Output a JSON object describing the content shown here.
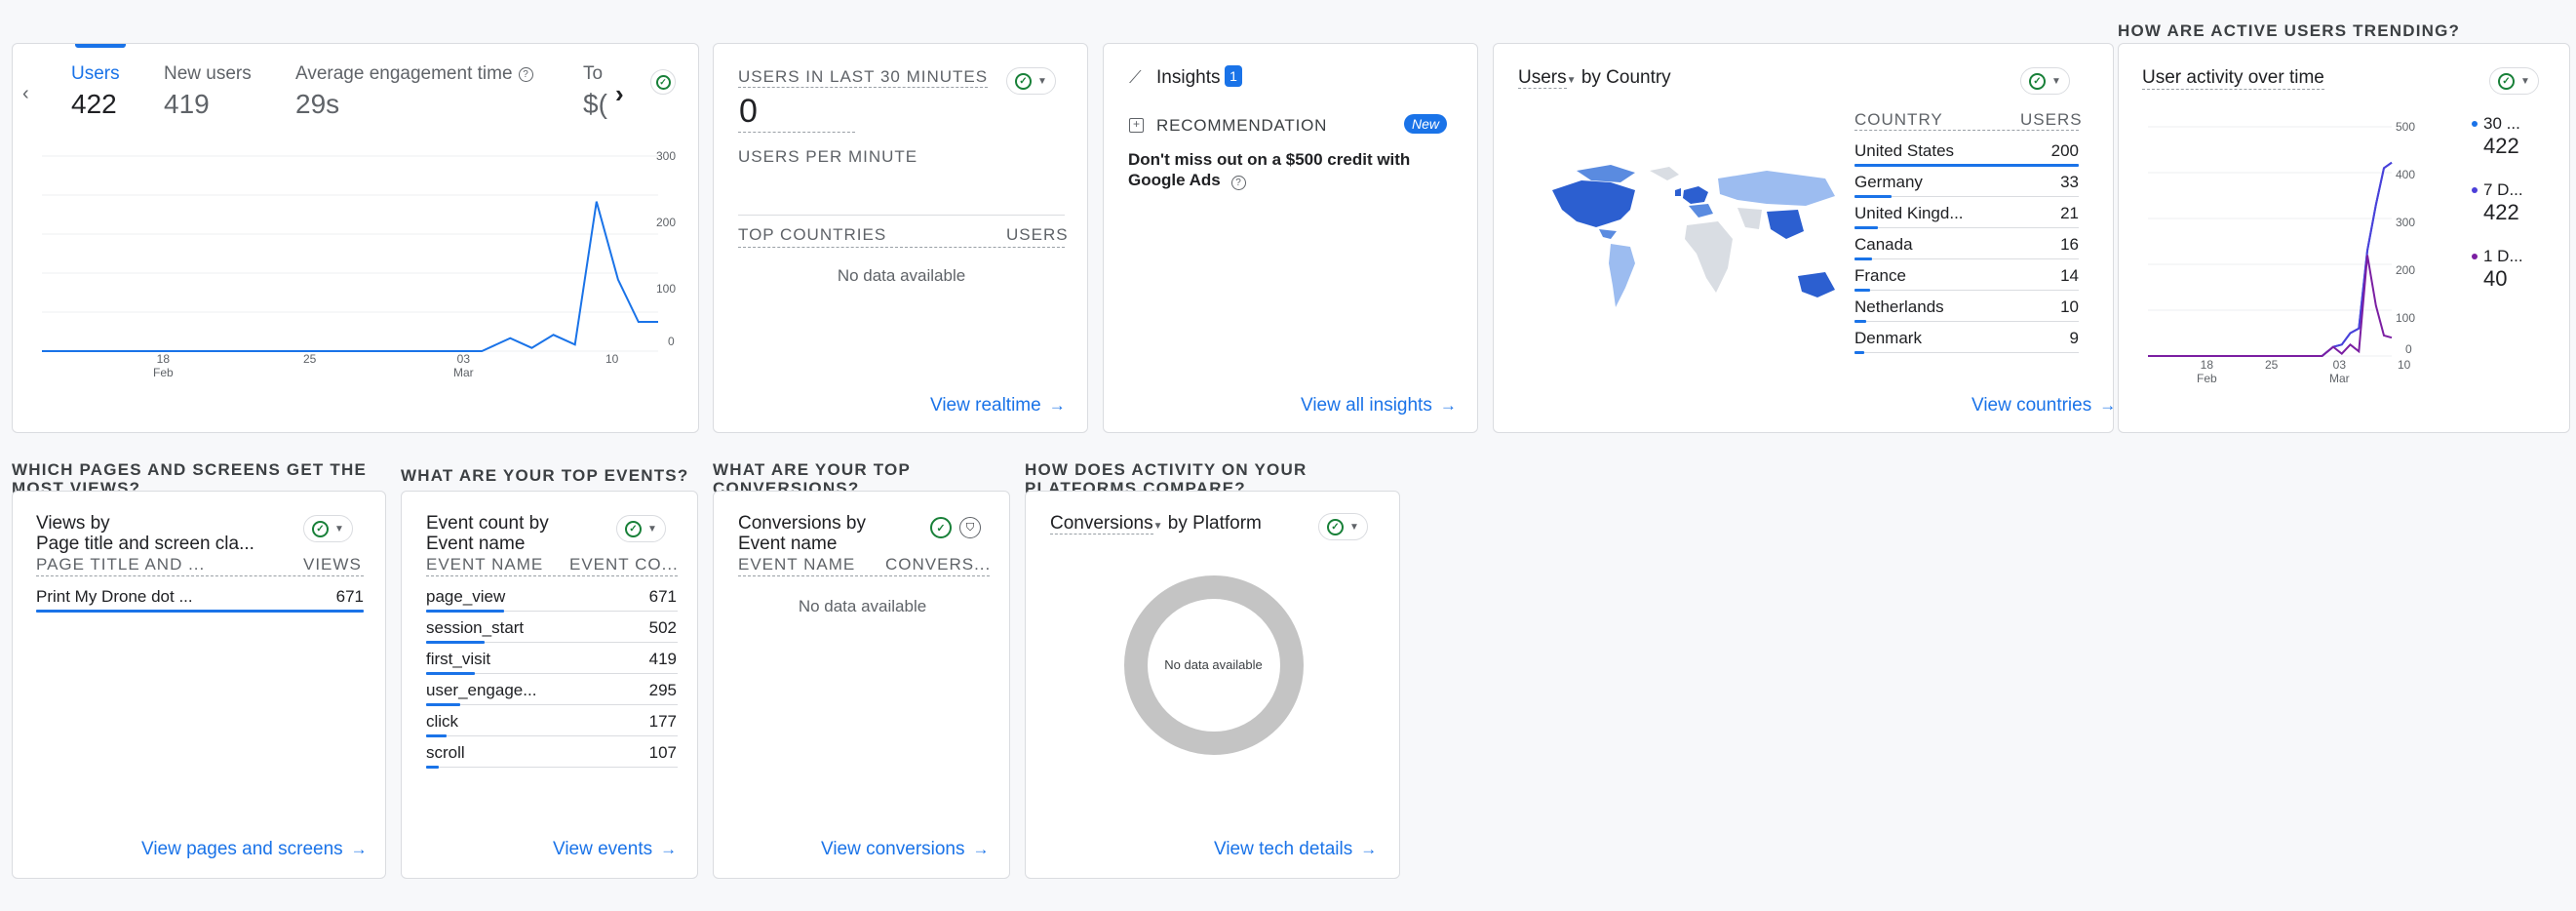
{
  "overview": {
    "metrics": [
      {
        "label": "Users",
        "value": "422"
      },
      {
        "label": "New users",
        "value": "419"
      },
      {
        "label": "Average engagement time",
        "value": "29s"
      },
      {
        "label": "To",
        "value": "$("
      }
    ],
    "y_ticks": [
      "300",
      "200",
      "100",
      "0"
    ],
    "x_ticks": [
      {
        "day": "18",
        "month": "Feb"
      },
      {
        "day": "25",
        "month": ""
      },
      {
        "day": "03",
        "month": "Mar"
      },
      {
        "day": "10",
        "month": ""
      }
    ]
  },
  "realtime": {
    "title": "USERS IN LAST 30 MINUTES",
    "value": "0",
    "per_minute": "USERS PER MINUTE",
    "col1": "TOP COUNTRIES",
    "col2": "USERS",
    "empty": "No data available",
    "link": "View realtime"
  },
  "insights": {
    "title": "Insights",
    "badge": "1",
    "rec_label": "RECOMMENDATION",
    "new_badge": "New",
    "text": "Don't miss out on a $500 credit with Google Ads",
    "link": "View all insights"
  },
  "countries": {
    "title_metric": "Users",
    "title_rest": "by Country",
    "col1": "COUNTRY",
    "col2": "USERS",
    "rows": [
      {
        "name": "United States",
        "value": "200"
      },
      {
        "name": "Germany",
        "value": "33"
      },
      {
        "name": "United Kingd...",
        "value": "21"
      },
      {
        "name": "Canada",
        "value": "16"
      },
      {
        "name": "France",
        "value": "14"
      },
      {
        "name": "Netherlands",
        "value": "10"
      },
      {
        "name": "Denmark",
        "value": "9"
      }
    ],
    "link": "View countries"
  },
  "trending": {
    "section": "HOW ARE ACTIVE USERS TRENDING?",
    "title": "User activity over time",
    "y_ticks": [
      "500",
      "400",
      "300",
      "200",
      "100",
      "0"
    ],
    "x_ticks": [
      {
        "day": "18",
        "month": "Feb"
      },
      {
        "day": "25",
        "month": ""
      },
      {
        "day": "03",
        "month": "Mar"
      },
      {
        "day": "10",
        "month": ""
      }
    ],
    "legend": [
      {
        "label": "30 ...",
        "value": "422",
        "color": "#1a73e8"
      },
      {
        "label": "7 D...",
        "value": "422",
        "color": "#4b3fd9"
      },
      {
        "label": "1 D...",
        "value": "40",
        "color": "#7b1fa2"
      }
    ]
  },
  "pages": {
    "section": "WHICH PAGES AND SCREENS GET THE MOST VIEWS?",
    "title_line1": "Views by",
    "title_line2": "Page title and screen cla...",
    "col1": "PAGE TITLE AND ...",
    "col2": "VIEWS",
    "rows": [
      {
        "name": "Print My Drone dot ...",
        "value": "671"
      }
    ],
    "link": "View pages and screens"
  },
  "events": {
    "section": "WHAT ARE YOUR TOP EVENTS?",
    "title_line1": "Event count by",
    "title_line2": "Event name",
    "col1": "EVENT NAME",
    "col2": "EVENT CO...",
    "rows": [
      {
        "name": "page_view",
        "value": "671"
      },
      {
        "name": "session_start",
        "value": "502"
      },
      {
        "name": "first_visit",
        "value": "419"
      },
      {
        "name": "user_engage...",
        "value": "295"
      },
      {
        "name": "click",
        "value": "177"
      },
      {
        "name": "scroll",
        "value": "107"
      }
    ],
    "link": "View events"
  },
  "conversions": {
    "section": "WHAT ARE YOUR TOP CONVERSIONS?",
    "title_line1": "Conversions by",
    "title_line2": "Event name",
    "col1": "EVENT NAME",
    "col2": "CONVERS...",
    "empty": "No data available",
    "link": "View conversions"
  },
  "platform": {
    "section": "HOW DOES ACTIVITY ON YOUR PLATFORMS COMPARE?",
    "title_metric": "Conversions",
    "title_rest": "by Platform",
    "empty": "No data available",
    "link": "View tech details"
  },
  "chart_data": [
    {
      "type": "line",
      "x": [
        "Feb 11",
        "Feb 18",
        "Feb 25",
        "Mar 03",
        "Mar 05",
        "Mar 06",
        "Mar 07",
        "Mar 08",
        "Mar 09",
        "Mar 10",
        "Mar 11",
        "Mar 12"
      ],
      "series": [
        {
          "name": "Users",
          "values": [
            0,
            0,
            0,
            0,
            20,
            5,
            25,
            10,
            230,
            110,
            45,
            45
          ]
        }
      ],
      "ylim": [
        0,
        300
      ]
    },
    {
      "type": "line",
      "x": [
        "Feb 11",
        "Feb 18",
        "Feb 25",
        "Mar 03",
        "Mar 05",
        "Mar 06",
        "Mar 07",
        "Mar 08",
        "Mar 09",
        "Mar 10",
        "Mar 11",
        "Mar 12"
      ],
      "series": [
        {
          "name": "30 ...",
          "values": [
            0,
            0,
            0,
            0,
            20,
            25,
            50,
            60,
            230,
            330,
            410,
            422
          ]
        },
        {
          "name": "7 D...",
          "values": [
            0,
            0,
            0,
            0,
            20,
            25,
            50,
            60,
            230,
            330,
            410,
            422
          ]
        },
        {
          "name": "1 D...",
          "values": [
            0,
            0,
            0,
            0,
            20,
            5,
            25,
            10,
            220,
            110,
            45,
            40
          ]
        }
      ],
      "ylim": [
        0,
        500
      ]
    }
  ]
}
